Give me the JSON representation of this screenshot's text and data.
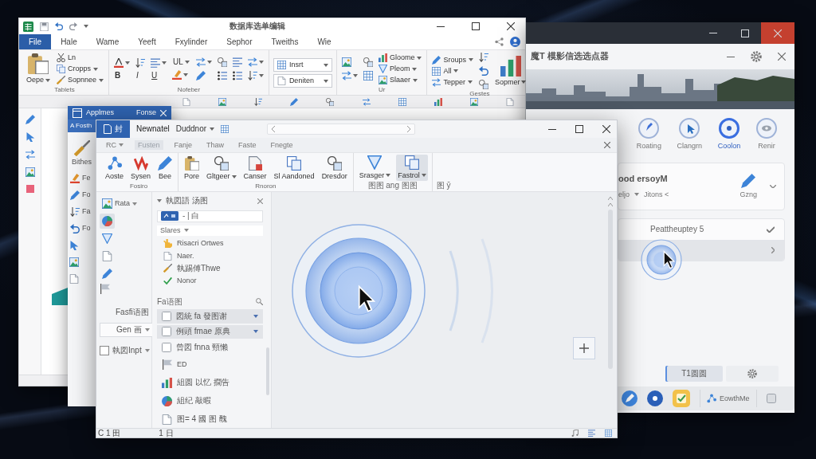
{
  "sheet_window": {
    "title": "数据库选单编辑",
    "tabs": [
      {
        "label": "File",
        "selected": true
      },
      {
        "label": "Hale",
        "selected": false
      },
      {
        "label": "Wame",
        "selected": false
      },
      {
        "label": "Yeeft",
        "selected": false
      },
      {
        "label": "Fxylinder",
        "selected": false
      },
      {
        "label": "Sephor",
        "selected": false
      },
      {
        "label": "Tweiths",
        "selected": false
      },
      {
        "label": "Wie",
        "selected": false
      }
    ],
    "ribbon": [
      {
        "label": "Tablets",
        "columns": [
          [
            {
              "kind": "large",
              "label": "Oepe",
              "dropdown": true
            }
          ],
          [
            {
              "kind": "small",
              "label": "Ln",
              "dropdown": false
            },
            {
              "kind": "small",
              "label": "Cropps",
              "dropdown": true
            },
            {
              "kind": "small",
              "label": "Sopnnee",
              "dropdown": true
            }
          ]
        ]
      },
      {
        "label": "Nofeber",
        "columns": [
          [
            {
              "kind": "icon",
              "dropdown": true
            },
            {
              "kind": "letter",
              "label": "B",
              "dropdown": false
            }
          ],
          [
            {
              "kind": "icon",
              "dropdown": false
            },
            {
              "kind": "letter",
              "label": "I",
              "dropdown": false
            }
          ],
          [
            {
              "kind": "icon",
              "dropdown": true
            },
            {
              "kind": "letter",
              "label": "U",
              "dropdown": false
            }
          ],
          [
            {
              "kind": "letter",
              "label": "UL",
              "dropdown": true
            },
            {
              "kind": "icon",
              "dropdown": true
            }
          ],
          [
            {
              "kind": "icon",
              "dropdown": true
            },
            {
              "kind": "icon",
              "dropdown": false
            }
          ],
          [
            {
              "kind": "icon",
              "dropdown": false
            },
            {
              "kind": "icon",
              "dropdown": false
            }
          ],
          [
            {
              "kind": "icon",
              "dropdown": false
            },
            {
              "kind": "icon",
              "dropdown": false
            }
          ],
          [
            {
              "kind": "icon",
              "dropdown": true
            },
            {
              "kind": "icon",
              "dropdown": true
            }
          ]
        ]
      },
      {
        "columns": [
          [
            {
              "kind": "field",
              "label": "Insrt",
              "dropdown": true
            },
            {
              "kind": "field",
              "label": "Deniten",
              "dropdown": true
            }
          ]
        ]
      },
      {
        "label": "Ur",
        "columns": [
          [
            {
              "kind": "icon",
              "dropdown": false
            },
            {
              "kind": "icon",
              "dropdown": true
            }
          ],
          [
            {
              "kind": "icon",
              "dropdown": false
            },
            {
              "kind": "icon",
              "dropdown": false
            }
          ],
          [
            {
              "kind": "small",
              "label": "Gloome",
              "dropdown": true
            },
            {
              "kind": "small",
              "label": "Pleom",
              "dropdown": true
            },
            {
              "kind": "small",
              "label": "Slaaer",
              "dropdown": true
            }
          ]
        ]
      },
      {
        "label": "Gestes",
        "columns": [
          [
            {
              "kind": "small",
              "label": "Sroups",
              "dropdown": true
            },
            {
              "kind": "small",
              "label": "All",
              "dropdown": true
            },
            {
              "kind": "small",
              "label": "Tepper",
              "dropdown": true
            }
          ],
          [
            {
              "kind": "icon",
              "dropdown": false
            },
            {
              "kind": "icon",
              "dropdown": false
            },
            {
              "kind": "icon",
              "dropdown": false
            }
          ],
          [
            {
              "kind": "large",
              "label": "Sopmer",
              "dropdown": true
            }
          ]
        ]
      }
    ]
  },
  "panel_window": {
    "title": "魔T 模影信选选点器",
    "actions": [
      {
        "label": "Roating",
        "selected": false
      },
      {
        "label": "Clangrn",
        "selected": false
      },
      {
        "label": "Coolon",
        "selected": true
      },
      {
        "label": "Renir",
        "selected": false
      }
    ],
    "card": {
      "title": "ood ersoyM",
      "field": "eljo",
      "value": "Jitons <",
      "tool": "Gzng"
    },
    "rows": [
      {
        "label": "Peattheuptey 5",
        "checked": true,
        "selected": false
      },
      {
        "checked": false,
        "selected": true
      }
    ],
    "primary_button": {
      "label": "T1圆圆",
      "selected": true
    },
    "taskbar_app": "EowthMe"
  },
  "side_window": {
    "title": "Applmes",
    "title_action": "Fonse",
    "tab": "A Fosth",
    "tools": [
      {
        "kind": "large",
        "label": "Bithes"
      },
      {
        "kind": "small",
        "label": "Fe"
      },
      {
        "kind": "small",
        "label": "Fo"
      },
      {
        "kind": "small",
        "label": "Fa"
      },
      {
        "kind": "small",
        "label": "Fo"
      }
    ]
  },
  "editor_window": {
    "file_tab": "封",
    "title": "Newnatel",
    "document": "Duddnor",
    "menu": [
      {
        "label": "RC",
        "dropdown": true,
        "selected": false
      },
      {
        "label": "Fusten",
        "dropdown": false,
        "selected": true
      },
      {
        "label": "Fanje",
        "dropdown": false,
        "selected": false
      },
      {
        "label": "Thaw",
        "dropdown": false,
        "selected": false
      },
      {
        "label": "Faste",
        "dropdown": false,
        "selected": false
      },
      {
        "label": "Fnegte",
        "dropdown": false,
        "selected": false
      }
    ],
    "ribbon": [
      {
        "label": "Fosiro",
        "columns": [
          [
            {
              "kind": "large",
              "label": "Aoste",
              "dropdown": false,
              "selected": false
            }
          ],
          [
            {
              "kind": "large",
              "label": "Sysen",
              "dropdown": false,
              "selected": false
            }
          ],
          [
            {
              "kind": "large",
              "label": "Bee",
              "dropdown": false,
              "selected": false
            }
          ]
        ]
      },
      {
        "label": "Rnoron",
        "columns": [
          [
            {
              "kind": "large",
              "label": "Pore",
              "dropdown": false,
              "selected": false
            }
          ],
          [
            {
              "kind": "large",
              "label": "Gltgeer",
              "dropdown": true,
              "selected": false
            }
          ],
          [
            {
              "kind": "large",
              "label": "Canser",
              "dropdown": false,
              "selected": false
            }
          ],
          [
            {
              "kind": "large",
              "label": "Sl Aandoned",
              "dropdown": false,
              "selected": false
            }
          ],
          [
            {
              "kind": "large",
              "label": "Dresdor",
              "dropdown": false,
              "selected": false
            }
          ]
        ]
      },
      {
        "label": "图图 ang 图图",
        "columns": [
          [
            {
              "kind": "large",
              "label": "Srasger",
              "dropdown": true,
              "selected": false
            }
          ],
          [
            {
              "kind": "large",
              "label": "Fastrol",
              "dropdown": true,
              "selected": true
            }
          ]
        ]
      },
      {
        "label": "图 ȳ"
      }
    ],
    "tools": [
      {
        "label": "Rata",
        "dropdown": true,
        "selected": false
      },
      {
        "dropdown": false,
        "selected": true
      },
      {
        "dropdown": false,
        "selected": false
      },
      {
        "dropdown": false,
        "selected": false
      },
      {
        "dropdown": false,
        "selected": false
      }
    ],
    "tool_caption": "Fasfi语图",
    "style_select": "Gen 画",
    "option": {
      "label": "執図Inpt",
      "checked": false
    },
    "nav_pane": {
      "title": "執図語 汤图",
      "filter": "- | 白",
      "sort": "Slares",
      "items": [
        {
          "label": "Risacri Ortwes"
        },
        {
          "label": "Naer."
        },
        {
          "label": "執踢傅Thwe"
        },
        {
          "label": "Nonor"
        }
      ],
      "section": "Fa语图",
      "entries": [
        {
          "kind": "check",
          "label": "図統 fa 發图谢",
          "selected": true
        },
        {
          "kind": "check",
          "label": "例頭 fmae 原典",
          "selected": true
        },
        {
          "kind": "check",
          "label": "曾図 fnna 頸懶",
          "selected": false
        },
        {
          "kind": "icon",
          "label": "ED",
          "selected": false
        },
        {
          "kind": "icon",
          "label": "組圆 以忆 撊告",
          "selected": false
        },
        {
          "kind": "icon",
          "label": "組纪 敲暇",
          "selected": false
        },
        {
          "kind": "icon",
          "label": "图= 4 國 图 醜",
          "selected": false
        }
      ]
    },
    "status": {
      "left": "C 1 田",
      "page": "1 日"
    }
  }
}
